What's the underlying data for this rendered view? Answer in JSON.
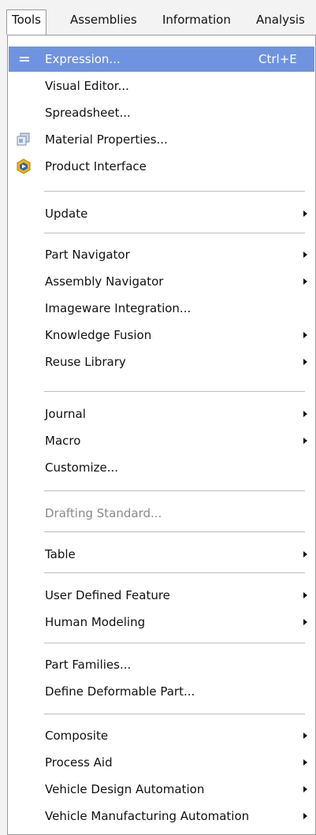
{
  "menubar": {
    "tools": "Tools",
    "assemblies": "Assemblies",
    "information": "Information",
    "analysis": "Analysis"
  },
  "menu": {
    "expression": "Expression...",
    "expression_shortcut": "Ctrl+E",
    "visual_editor": "Visual Editor...",
    "spreadsheet": "Spreadsheet...",
    "material_properties": "Material Properties...",
    "product_interface": "Product Interface",
    "update": "Update",
    "part_navigator": "Part Navigator",
    "assembly_navigator": "Assembly Navigator",
    "imageware_integration": "Imageware Integration...",
    "knowledge_fusion": "Knowledge Fusion",
    "reuse_library": "Reuse Library",
    "journal": "Journal",
    "macro": "Macro",
    "customize": "Customize...",
    "drafting_standard": "Drafting Standard...",
    "table": "Table",
    "user_defined_feature": "User Defined Feature",
    "human_modeling": "Human Modeling",
    "part_families": "Part Families...",
    "define_deformable_part": "Define Deformable Part...",
    "composite": "Composite",
    "process_aid": "Process Aid",
    "vehicle_design_automation": "Vehicle Design Automation",
    "vehicle_manufacturing_automation": "Vehicle Manufacturing Automation"
  },
  "colors": {
    "highlight": "#6f93df",
    "menubar_bg": "#f3f3f3",
    "disabled_text": "#8a8a8a"
  },
  "icons": {
    "expression": "equals-icon",
    "material_properties": "material-properties-icon",
    "product_interface": "product-interface-icon",
    "submenu": "submenu-arrow-icon"
  }
}
